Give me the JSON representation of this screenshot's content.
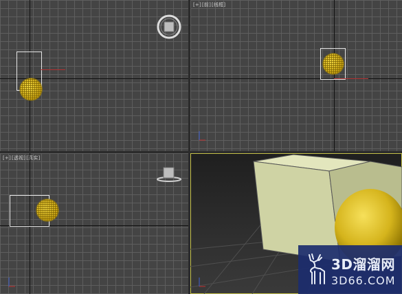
{
  "viewports": {
    "top": {
      "labels": []
    },
    "front": {
      "labels": [
        "[+]",
        "[前]",
        "[线框]"
      ]
    },
    "left": {
      "labels": [
        "[+]",
        "[透视]",
        "[真实]"
      ]
    },
    "perspective": {
      "labels": [],
      "active": true
    }
  },
  "watermark": {
    "title": "3D溜溜网",
    "url": "3D66.COM"
  },
  "colors": {
    "grid_bg": "#444444",
    "grid_line": "#606060",
    "active_border": "#c6c24a",
    "sphere": "#d8b820",
    "box": "#d8dbb0",
    "watermark_bg": "#1c2c6e"
  },
  "icons": [
    "viewcube-ring-icon",
    "viewcube-icon",
    "deer-logo-icon"
  ]
}
